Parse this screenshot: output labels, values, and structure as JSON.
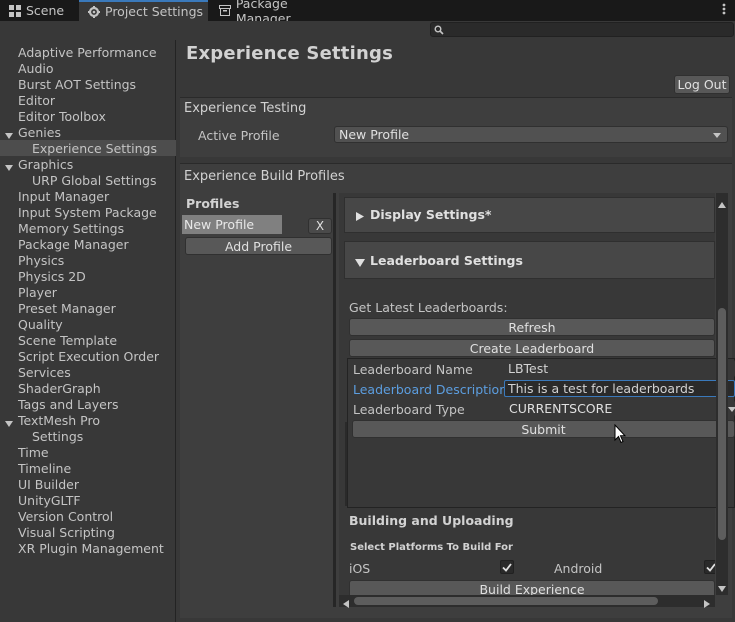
{
  "tabs": [
    {
      "label": "Scene",
      "icon": "grid-icon"
    },
    {
      "label": "Project Settings",
      "icon": "gear-icon"
    },
    {
      "label": "Package Manager",
      "icon": "package-icon"
    }
  ],
  "search": {
    "placeholder": ""
  },
  "sidebar": {
    "items": [
      "Adaptive Performance",
      "Audio",
      "Burst AOT Settings",
      "Editor",
      "Editor Toolbox",
      "Genies",
      "Experience Settings",
      "Graphics",
      "URP Global Settings",
      "Input Manager",
      "Input System Package",
      "Memory Settings",
      "Package Manager",
      "Physics",
      "Physics 2D",
      "Player",
      "Preset Manager",
      "Quality",
      "Scene Template",
      "Script Execution Order",
      "Services",
      "ShaderGraph",
      "Tags and Layers",
      "TextMesh Pro",
      "Settings",
      "Time",
      "Timeline",
      "UI Builder",
      "UnityGLTF",
      "Version Control",
      "Visual Scripting",
      "XR Plugin Management"
    ],
    "selected": "Experience Settings"
  },
  "page": {
    "title": "Experience Settings",
    "logout_label": "Log Out"
  },
  "testing": {
    "header": "Experience Testing",
    "active_profile_label": "Active Profile",
    "active_profile_value": "New Profile"
  },
  "build_profiles": {
    "header": "Experience Build Profiles",
    "profiles_label": "Profiles",
    "profile_name": "New Profile",
    "remove_label": "X",
    "add_profile_label": "Add Profile"
  },
  "display_settings": {
    "label": "Display Settings*"
  },
  "leaderboard": {
    "label": "Leaderboard Settings",
    "get_latest_label": "Get Latest Leaderboards:",
    "refresh_label": "Refresh",
    "create_label": "Create Leaderboard",
    "name_label": "Leaderboard Name",
    "name_value": "LBTest",
    "desc_label": "Leaderboard Description",
    "desc_value": "This is a test for leaderboards",
    "type_label": "Leaderboard Type",
    "type_value": "CURRENTSCORE",
    "submit_label": "Submit"
  },
  "building": {
    "header": "Building and Uploading",
    "platforms_label": "Select Platforms To Build For",
    "ios_label": "iOS",
    "ios_checked": true,
    "android_label": "Android",
    "android_checked": true,
    "build_label": "Build Experience"
  },
  "colors": {
    "accent": "#3a79bb",
    "panel": "#383838",
    "highlight_text": "#5c9ee0"
  }
}
